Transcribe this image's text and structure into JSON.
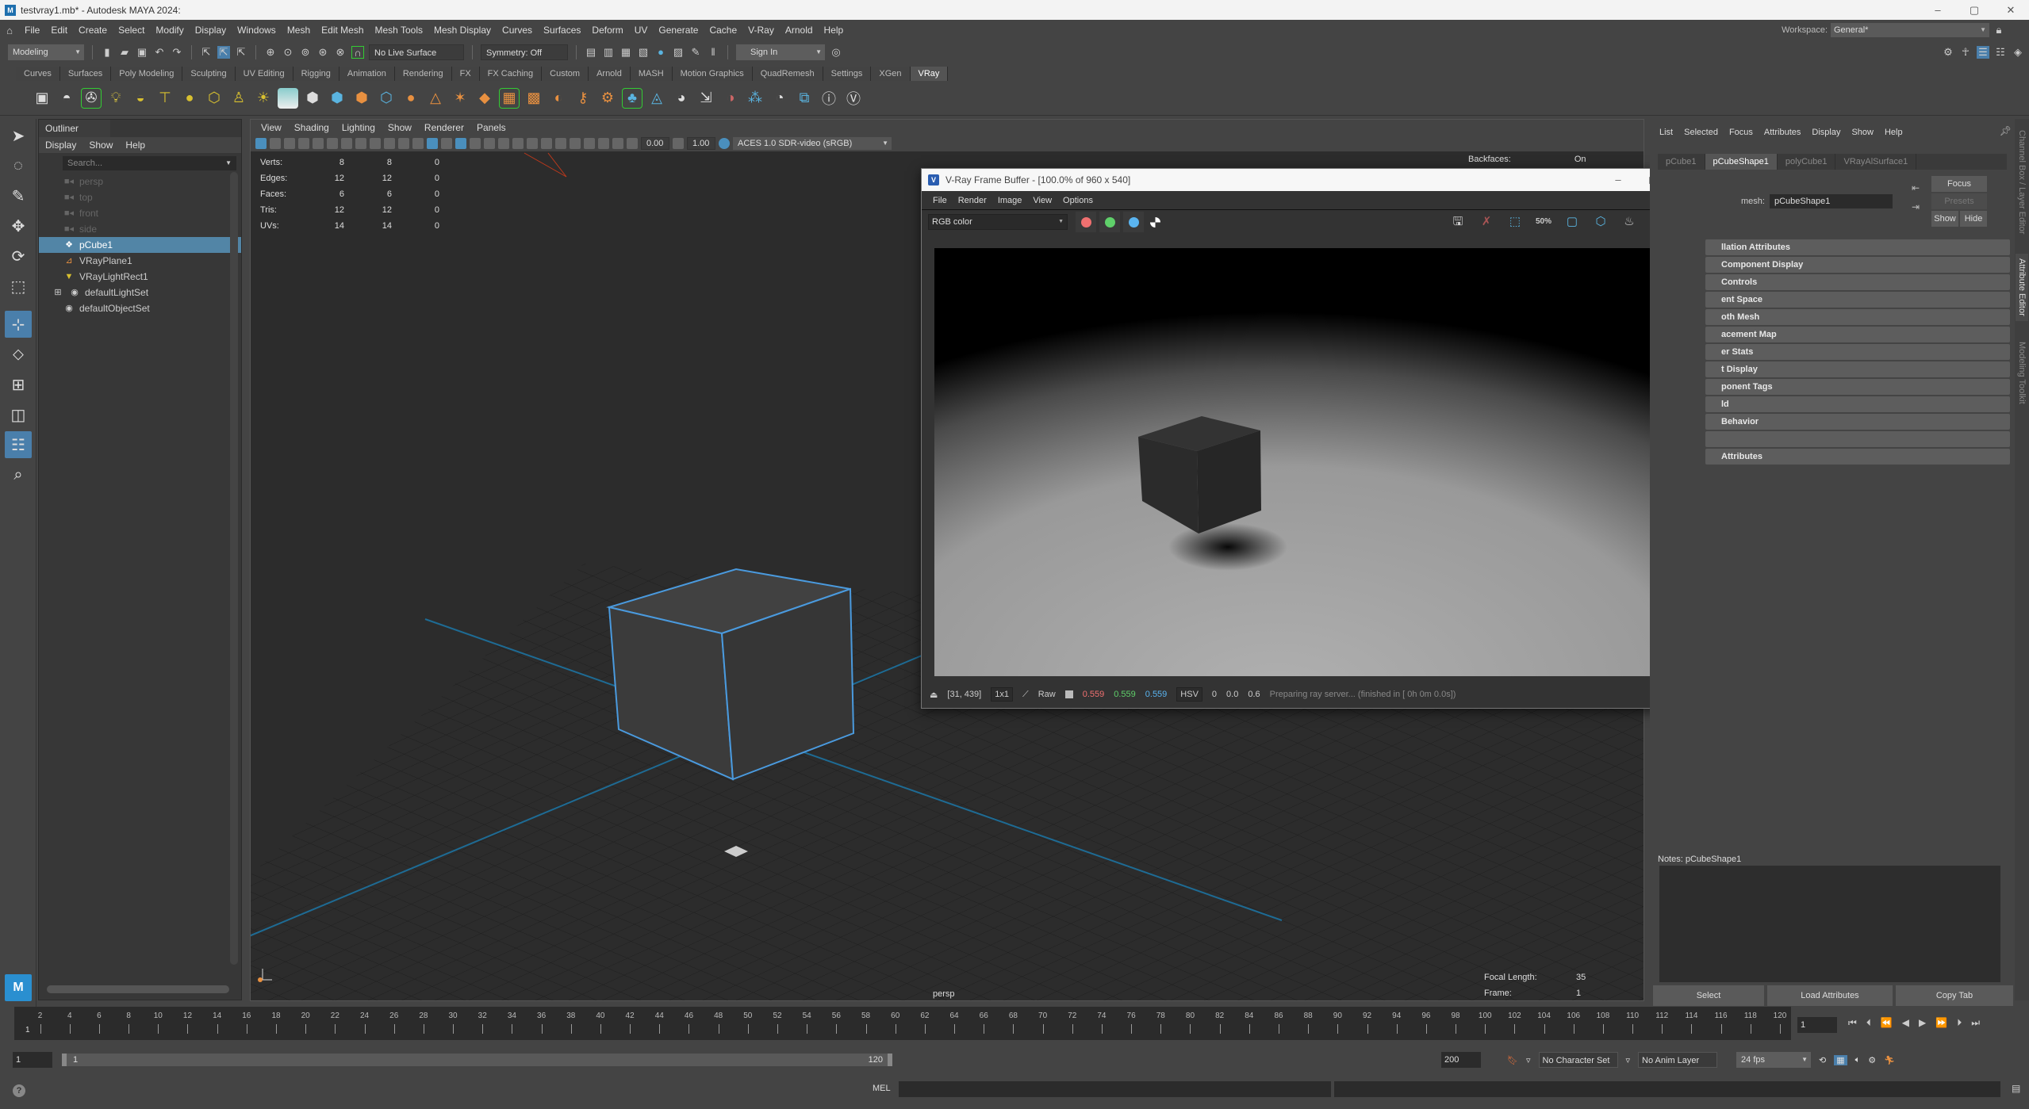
{
  "window": {
    "title": "testvray1.mb* - Autodesk MAYA 2024:",
    "controls": [
      "–",
      "▢",
      "✕"
    ]
  },
  "menubar": {
    "items": [
      "File",
      "Edit",
      "Create",
      "Select",
      "Modify",
      "Display",
      "Windows",
      "Mesh",
      "Edit Mesh",
      "Mesh Tools",
      "Mesh Display",
      "Curves",
      "Surfaces",
      "Deform",
      "UV",
      "Generate",
      "Cache",
      "V-Ray",
      "Arnold",
      "Help"
    ],
    "workspace_label": "Workspace:",
    "workspace_value": "General*"
  },
  "statusline": {
    "mode": "Modeling",
    "live_surface": "No Live Surface",
    "symmetry": "Symmetry: Off",
    "sign_in": "Sign In"
  },
  "shelf": {
    "tabs": [
      "Curves",
      "Surfaces",
      "Poly Modeling",
      "Sculpting",
      "UV Editing",
      "Rigging",
      "Animation",
      "Rendering",
      "FX",
      "FX Caching",
      "Custom",
      "Arnold",
      "MASH",
      "Motion Graphics",
      "QuadRemesh",
      "Settings",
      "XGen",
      "VRay"
    ],
    "active_tab": "VRay"
  },
  "outliner": {
    "title": "Outliner",
    "menu": [
      "Display",
      "Show",
      "Help"
    ],
    "search_placeholder": "Search...",
    "items": [
      {
        "label": "persp",
        "icon": "camera-icon",
        "dim": true
      },
      {
        "label": "top",
        "icon": "camera-icon",
        "dim": true
      },
      {
        "label": "front",
        "icon": "camera-icon",
        "dim": true
      },
      {
        "label": "side",
        "icon": "camera-icon",
        "dim": true
      },
      {
        "label": "pCube1",
        "icon": "mesh-icon",
        "selected": true
      },
      {
        "label": "VRayPlane1",
        "icon": "vray-plane-icon"
      },
      {
        "label": "VRayLightRect1",
        "icon": "vray-light-icon"
      },
      {
        "label": "defaultLightSet",
        "icon": "set-icon",
        "expandable": true
      },
      {
        "label": "defaultObjectSet",
        "icon": "set-icon"
      }
    ]
  },
  "viewport": {
    "menu": [
      "View",
      "Shading",
      "Lighting",
      "Show",
      "Renderer",
      "Panels"
    ],
    "exposure": "0.00",
    "gamma": "1.00",
    "color_space": "ACES 1.0 SDR-video (sRGB)",
    "hud": [
      {
        "label": "Verts:",
        "v1": "8",
        "v2": "8",
        "v3": "0"
      },
      {
        "label": "Edges:",
        "v1": "12",
        "v2": "12",
        "v3": "0"
      },
      {
        "label": "Faces:",
        "v1": "6",
        "v2": "6",
        "v3": "0"
      },
      {
        "label": "Tris:",
        "v1": "12",
        "v2": "12",
        "v3": "0"
      },
      {
        "label": "UVs:",
        "v1": "14",
        "v2": "14",
        "v3": "0"
      }
    ],
    "backfaces_label": "Backfaces:",
    "backfaces_value": "On",
    "focal_length_label": "Focal Length:",
    "focal_length_value": "35",
    "frame_label": "Frame:",
    "frame_value": "1",
    "camera": "persp"
  },
  "vfb": {
    "title": "V-Ray Frame Buffer - [100.0% of 960 x 540]",
    "menu": [
      "File",
      "Render",
      "Image",
      "View",
      "Options"
    ],
    "channel": "RGB color",
    "status": {
      "coords": "[31, 439]",
      "zoom": "1x1",
      "mode": "Raw",
      "r": "0.559",
      "g": "0.559",
      "b": "0.559",
      "colorspace": "HSV",
      "h": "0",
      "s": "0.0",
      "v": "0.6",
      "message": "Preparing ray server... (finished in [ 0h  0m  0.0s])"
    },
    "colors": {
      "red": "#f07070",
      "green": "#5fd06a",
      "blue": "#5ab4f0"
    }
  },
  "attribute_editor": {
    "menu": [
      "List",
      "Selected",
      "Focus",
      "Attributes",
      "Display",
      "Show",
      "Help"
    ],
    "tabs": [
      "pCube1",
      "pCubeShape1",
      "polyCube1",
      "VRayAlSurface1"
    ],
    "active_tab": "pCubeShape1",
    "mesh_label": "mesh:",
    "mesh_value": "pCubeShape1",
    "focus_btn": "Focus",
    "presets_btn": "Presets",
    "show_btn": "Show",
    "hide_btn": "Hide",
    "sections": [
      "llation Attributes",
      "Component Display",
      "Controls",
      "ent Space",
      "oth Mesh",
      "acement Map",
      "er Stats",
      "t Display",
      "ponent Tags",
      "ld",
      "Behavior",
      "",
      "Attributes"
    ],
    "notes_label": "Notes:  pCubeShape1",
    "bottom_buttons": [
      "Select",
      "Load Attributes",
      "Copy Tab"
    ],
    "side_tabs": [
      "Channel Box / Layer Editor",
      "Attribute Editor",
      "Modeling Toolkit"
    ]
  },
  "timeline": {
    "ticks": [
      "2",
      "4",
      "6",
      "8",
      "10",
      "12",
      "14",
      "16",
      "18",
      "20",
      "22",
      "24",
      "26",
      "28",
      "30",
      "32",
      "34",
      "36",
      "38",
      "40",
      "42",
      "44",
      "46",
      "48",
      "50",
      "52",
      "54",
      "56",
      "58",
      "60",
      "62",
      "64",
      "66",
      "68",
      "70",
      "72",
      "74",
      "76",
      "78",
      "80",
      "82",
      "84",
      "86",
      "88",
      "90",
      "92",
      "94",
      "96",
      "98",
      "100",
      "102",
      "104",
      "106",
      "108",
      "110",
      "112",
      "114",
      "116",
      "118",
      "120"
    ],
    "current_frame": "1",
    "current_field": "1"
  },
  "range": {
    "start": "1",
    "slider_start": "1",
    "slider_end": "120",
    "anim_end": "200",
    "character_set": "No Character Set",
    "anim_layer": "No Anim Layer",
    "fps": "24 fps"
  },
  "cmdline": {
    "lang": "MEL"
  }
}
